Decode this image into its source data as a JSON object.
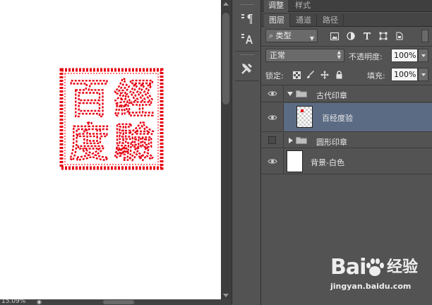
{
  "canvas": {
    "zoom": "15.09%",
    "stamp_chars": [
      "百",
      "經",
      "度",
      "驗"
    ],
    "stamp_color": "#e60012"
  },
  "panel": {
    "top_tabs": [
      "调整",
      "样式"
    ],
    "sub_tabs": [
      "图层",
      "通道",
      "路径"
    ],
    "filter": {
      "label": "类型",
      "icons": [
        "image-filter-icon",
        "adjustment-filter-icon",
        "type-filter-icon",
        "shape-filter-icon",
        "smart-object-filter-icon"
      ]
    },
    "blend_mode": "正常",
    "opacity_label": "不透明度:",
    "opacity_value": "100%",
    "lock_label": "锁定:",
    "fill_label": "填充:",
    "fill_value": "100%",
    "layers": [
      {
        "name": "古代印章",
        "type": "group",
        "expanded": true,
        "visible": true
      },
      {
        "name": "百经度验",
        "type": "layer",
        "visible": true,
        "selected": true,
        "indent": true
      },
      {
        "name": "圆形印章",
        "type": "group",
        "expanded": false,
        "visible": false
      },
      {
        "name": "背景-白色",
        "type": "layer",
        "visible": true
      }
    ]
  },
  "colors": {
    "selected_layer": "#5b6b84",
    "panel_bg": "#535353",
    "stamp_red": "#e60012"
  },
  "watermark": {
    "brand": "Bai",
    "brand_cn": "经验",
    "url": "jingyan.baidu.com"
  }
}
